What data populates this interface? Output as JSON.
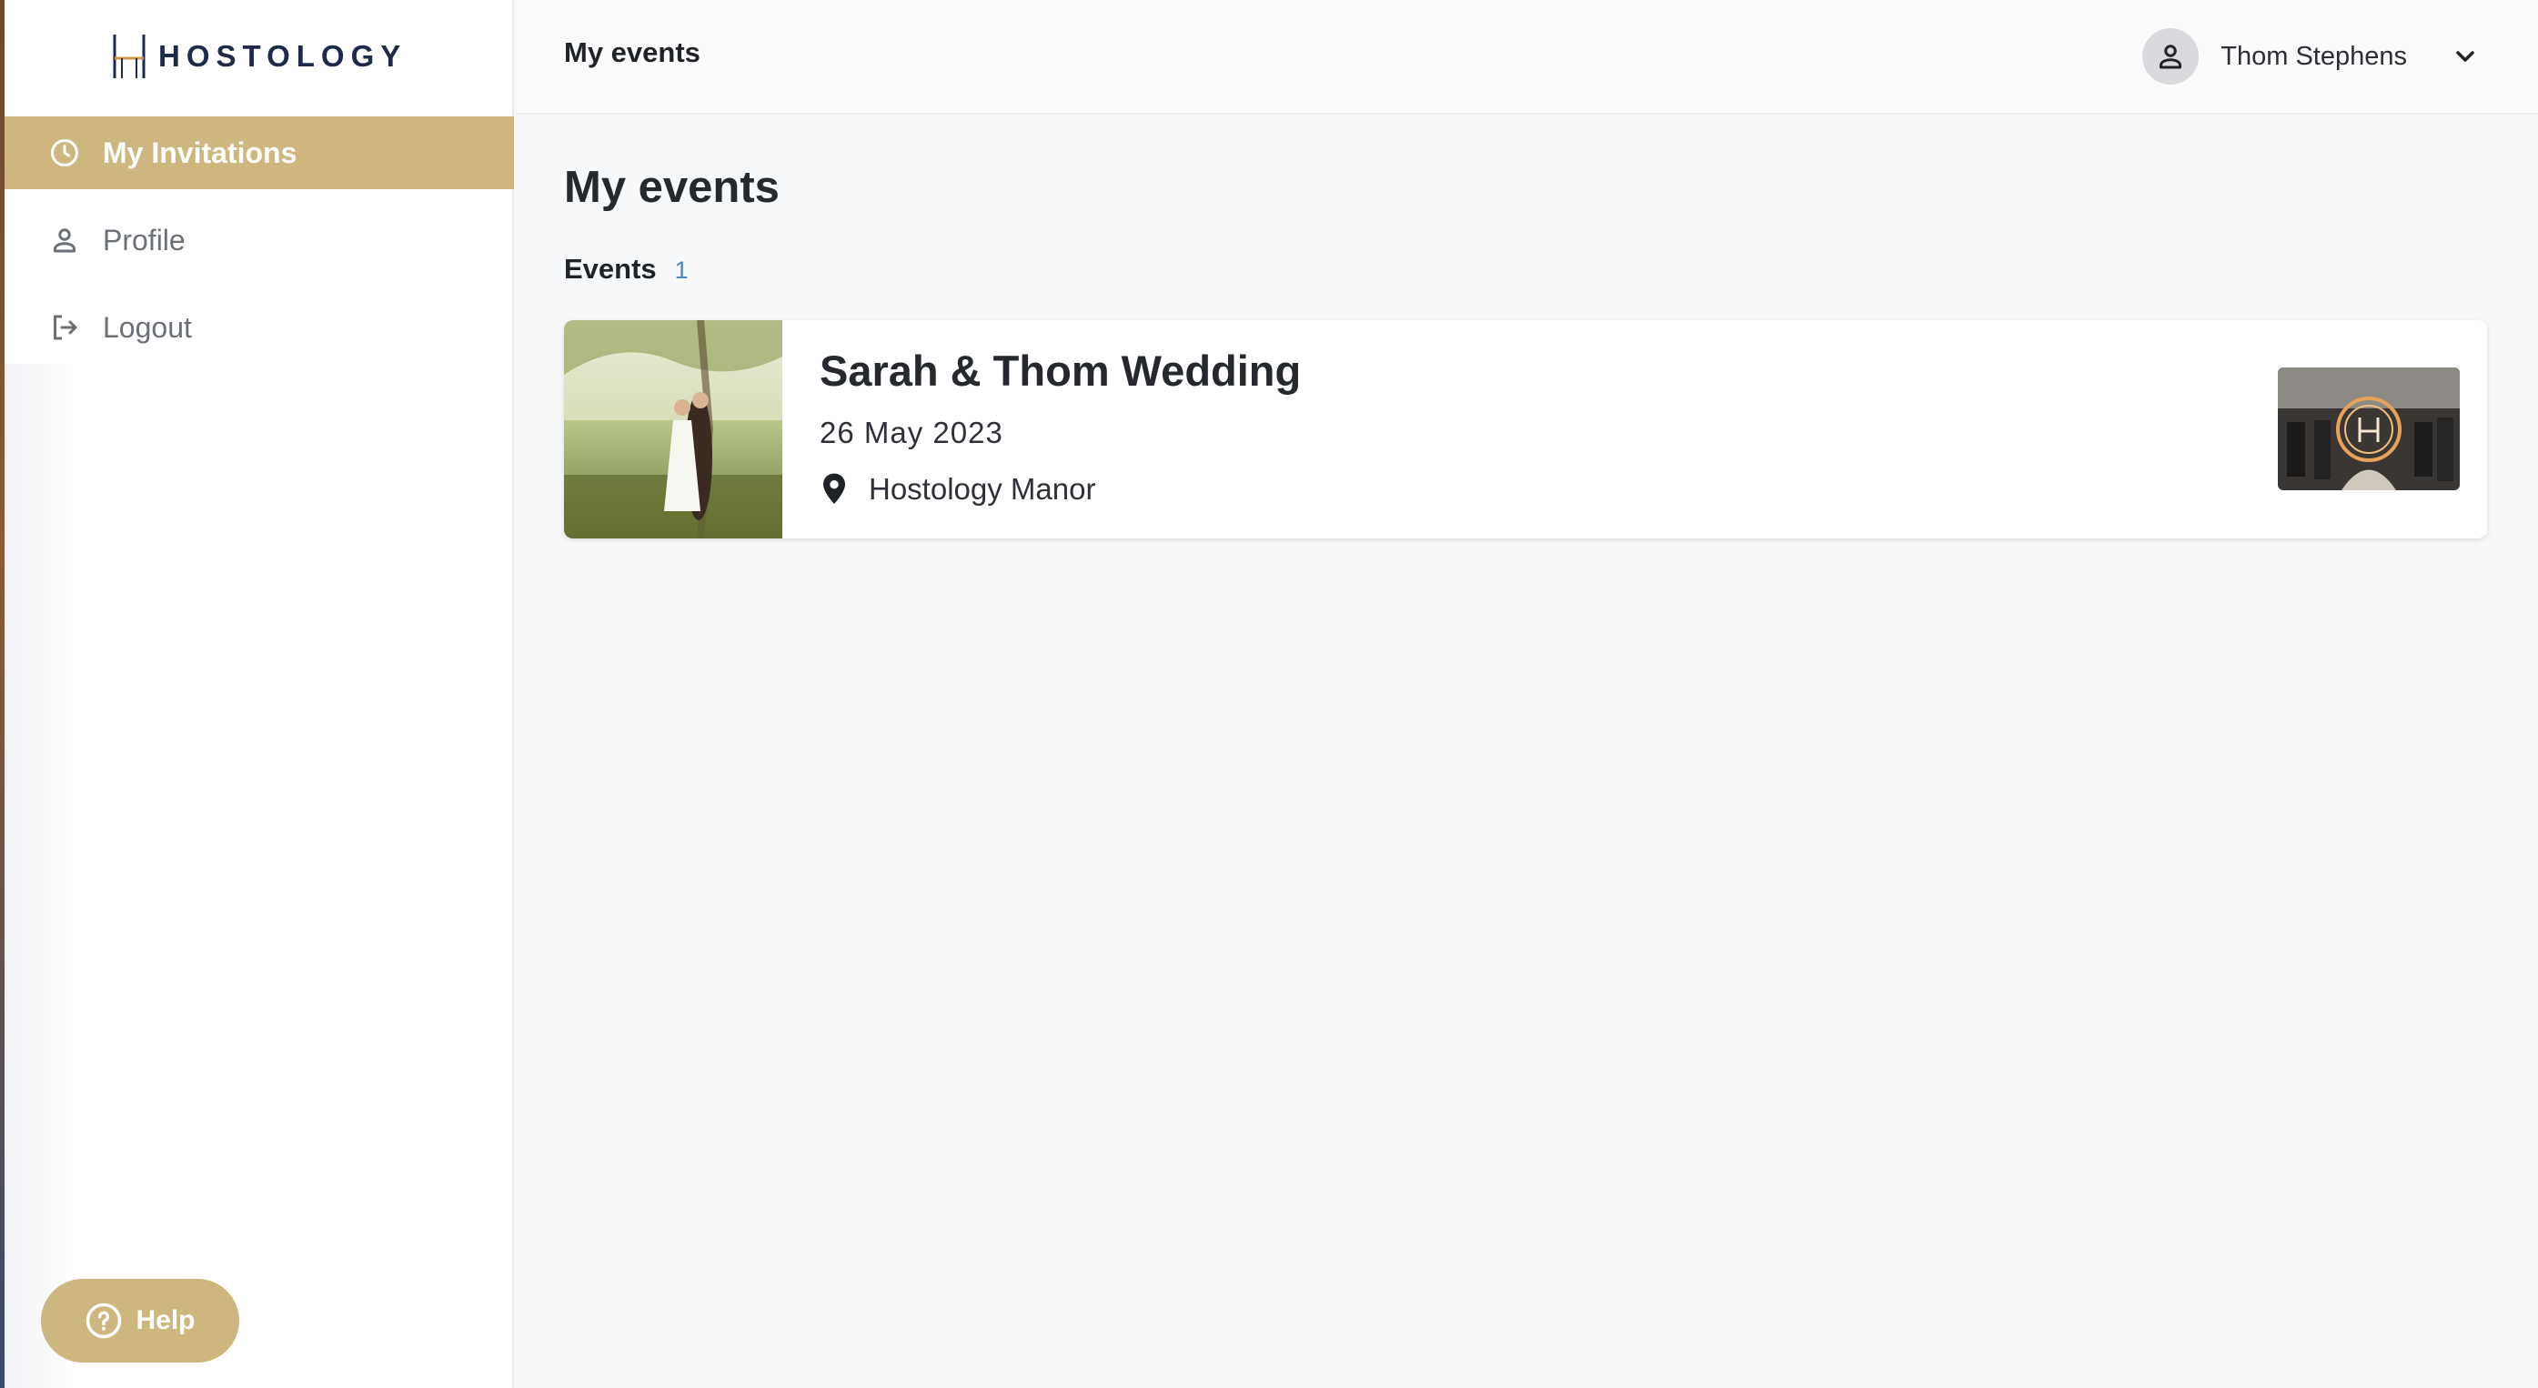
{
  "brand": {
    "name": "HOSTOLOGY"
  },
  "sidebar": {
    "items": [
      {
        "label": "My Invitations",
        "icon": "clock-icon",
        "active": true
      },
      {
        "label": "Profile",
        "icon": "person-icon",
        "active": false
      },
      {
        "label": "Logout",
        "icon": "logout-icon",
        "active": false
      }
    ],
    "help_label": "Help"
  },
  "topbar": {
    "title": "My events",
    "user_name": "Thom Stephens"
  },
  "main": {
    "page_title": "My events",
    "section_label": "Events",
    "section_count": "1",
    "events": [
      {
        "title": "Sarah & Thom Wedding",
        "date": "26 May 2023",
        "location": "Hostology Manor"
      }
    ]
  },
  "colors": {
    "accent": "#cdb77f",
    "brand_navy": "#1d2a4a",
    "count_blue": "#4c86c6"
  }
}
